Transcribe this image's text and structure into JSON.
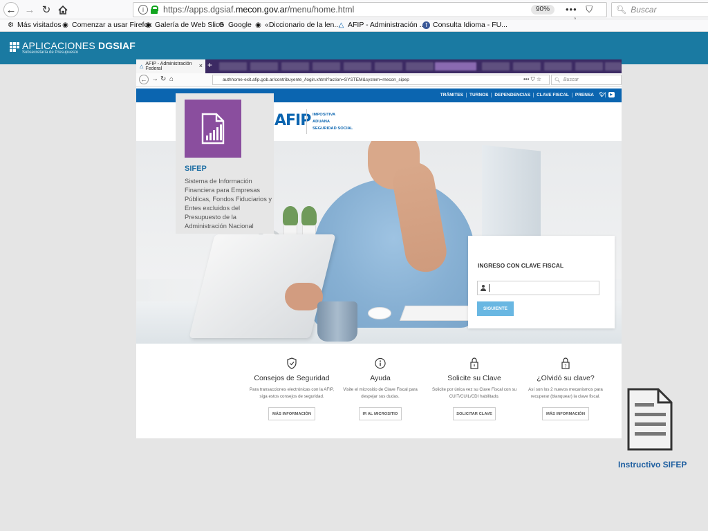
{
  "browser": {
    "url_prefix": "https://apps.dgsiaf.",
    "url_domain": "mecon.gov.ar",
    "url_path": "/menu/home.html",
    "zoom": "90%",
    "search_placeholder": "Buscar",
    "bookmarks": [
      {
        "label": "Más visitados",
        "icon": "gear-icon"
      },
      {
        "label": "Comenzar a usar Firefox",
        "icon": "globe-icon"
      },
      {
        "label": "Galería de Web Slice",
        "icon": "globe-icon"
      },
      {
        "label": "Google",
        "icon": "google-icon"
      },
      {
        "label": "«Diccionario de la len...",
        "icon": "globe-icon"
      },
      {
        "label": "AFIP - Administración ...",
        "icon": "afip-icon"
      },
      {
        "label": "Consulta Idioma - FU...",
        "icon": "facebook-icon"
      }
    ]
  },
  "header": {
    "title_light": "APLICACIONES ",
    "title_bold": "DGSIAF",
    "subtitle": "Subsecretaría de Presupuesto",
    "bg_color": "#1a7aa2"
  },
  "embedded": {
    "tab_title": "AFIP - Administración Federal",
    "url": "authhome-exit.afip.gob.ar/contribuyente_/login.xhtml?action=SYSTEM&system=mecon_sipep",
    "search_placeholder": "Buscar",
    "nav": [
      "TRÁMITES",
      "TURNOS",
      "DEPENDENCIAS",
      "CLAVE FISCAL",
      "PRENSA"
    ],
    "logo_wordmark": "AFIP",
    "categories": [
      "IMPOSITIVA",
      "ADUANA",
      "SEGURIDAD SOCIAL"
    ],
    "login": {
      "title": "INGRESO CON CLAVE FISCAL",
      "button": "SIGUIENTE"
    },
    "features": [
      {
        "title": "Consejos de Seguridad",
        "desc": "Para transacciones electrónicas con la AFIP, siga estos consejos de seguridad.",
        "button": "MÁS INFORMACIÓN",
        "icon": "shield-icon"
      },
      {
        "title": "Ayuda",
        "desc": "Visite el micrositio de Clave Fiscal para despejar sus dudas.",
        "button": "IR AL MICROSITIO",
        "icon": "info-icon"
      },
      {
        "title": "Solicite su Clave",
        "desc": "Solicite por única vez su Clave Fiscal con su CUIT/CUIL/CDI habilitado.",
        "button": "SOLICITAR CLAVE",
        "icon": "lock-icon"
      },
      {
        "title": "¿Olvidó su clave?",
        "desc": "Así son los 2 nuevos mecanismos para recuperar (blanquear) la clave fiscal.",
        "button": "MÁS INFORMACIÓN",
        "icon": "lock-question-icon"
      }
    ]
  },
  "sifep": {
    "title": "SIFEP",
    "description": "Sistema de Información Financiera para Empresas Públicas, Fondos Fiduciarios y Entes excluidos del Presupuesto de la Administración Nacional",
    "tile_color": "#8a4e9e"
  },
  "instructivo": {
    "label": "Instructivo SIFEP"
  }
}
